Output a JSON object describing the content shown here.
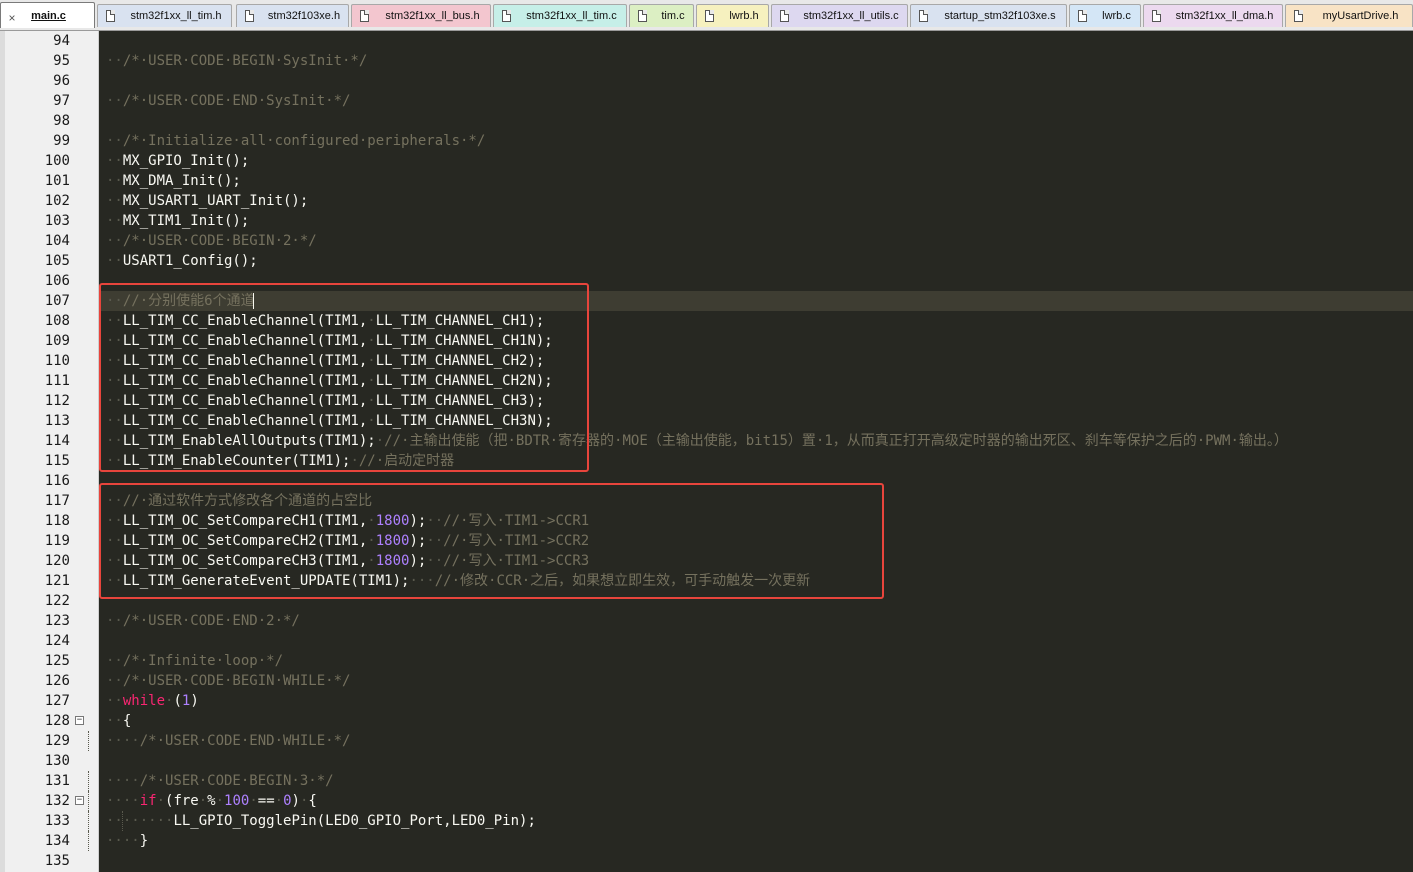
{
  "tabs": [
    {
      "label": "main.c",
      "color": "#ffffff",
      "active": true
    },
    {
      "label": "stm32f1xx_ll_tim.h",
      "color": "#d9e2f0"
    },
    {
      "label": "stm32f103xe.h",
      "color": "#d9e2f0"
    },
    {
      "label": "stm32f1xx_ll_bus.h",
      "color": "#f3c6cf"
    },
    {
      "label": "stm32f1xx_ll_tim.c",
      "color": "#c6efe8"
    },
    {
      "label": "tim.c",
      "color": "#dcefc3"
    },
    {
      "label": "lwrb.h",
      "color": "#f6f1bf"
    },
    {
      "label": "stm32f1xx_ll_utils.c",
      "color": "#ddd8f0"
    },
    {
      "label": "startup_stm32f103xe.s",
      "color": "#d9e2f0"
    },
    {
      "label": "lwrb.c",
      "color": "#d4e6f6"
    },
    {
      "label": "stm32f1xx_ll_dma.h",
      "color": "#ecd9ef"
    },
    {
      "label": "myUsartDrive.h",
      "color": "#f8e3c5"
    }
  ],
  "tab_close_glyph": "×",
  "lines": [
    {
      "n": "94",
      "code": ""
    },
    {
      "n": "95",
      "code": "  /* USER CODE BEGIN SysInit */"
    },
    {
      "n": "96",
      "code": ""
    },
    {
      "n": "97",
      "code": "  /* USER CODE END SysInit */"
    },
    {
      "n": "98",
      "code": ""
    },
    {
      "n": "99",
      "code": "  /* Initialize all configured peripherals */"
    },
    {
      "n": "100",
      "code": "  MX_GPIO_Init();"
    },
    {
      "n": "101",
      "code": "  MX_DMA_Init();"
    },
    {
      "n": "102",
      "code": "  MX_USART1_UART_Init();"
    },
    {
      "n": "103",
      "code": "  MX_TIM1_Init();"
    },
    {
      "n": "104",
      "code": "  /* USER CODE BEGIN 2 */"
    },
    {
      "n": "105",
      "code": "  USART1_Config();"
    },
    {
      "n": "106",
      "code": ""
    },
    {
      "n": "107",
      "code": "  // 分别使能6个通道"
    },
    {
      "n": "108",
      "code": "  LL_TIM_CC_EnableChannel(TIM1, LL_TIM_CHANNEL_CH1);"
    },
    {
      "n": "109",
      "code": "  LL_TIM_CC_EnableChannel(TIM1, LL_TIM_CHANNEL_CH1N);"
    },
    {
      "n": "110",
      "code": "  LL_TIM_CC_EnableChannel(TIM1, LL_TIM_CHANNEL_CH2);"
    },
    {
      "n": "111",
      "code": "  LL_TIM_CC_EnableChannel(TIM1, LL_TIM_CHANNEL_CH2N);"
    },
    {
      "n": "112",
      "code": "  LL_TIM_CC_EnableChannel(TIM1, LL_TIM_CHANNEL_CH3);"
    },
    {
      "n": "113",
      "code": "  LL_TIM_CC_EnableChannel(TIM1, LL_TIM_CHANNEL_CH3N);"
    },
    {
      "n": "114",
      "code": "  LL_TIM_EnableAllOutputs(TIM1); // 主输出使能（把 BDTR 寄存器的 MOE（主输出使能，bit15）置 1，从而真正打开高级定时器的输出死区、刹车等保护之后的 PWM 输出。）"
    },
    {
      "n": "115",
      "code": "  LL_TIM_EnableCounter(TIM1); // 启动定时器"
    },
    {
      "n": "116",
      "code": ""
    },
    {
      "n": "117",
      "code": "  // 通过软件方式修改各个通道的占空比"
    },
    {
      "n": "118",
      "code": "  LL_TIM_OC_SetCompareCH1(TIM1, 1800);  // 写入 TIM1->CCR1"
    },
    {
      "n": "119",
      "code": "  LL_TIM_OC_SetCompareCH2(TIM1, 1800);  // 写入 TIM1->CCR2"
    },
    {
      "n": "120",
      "code": "  LL_TIM_OC_SetCompareCH3(TIM1, 1800);  // 写入 TIM1->CCR3"
    },
    {
      "n": "121",
      "code": "  LL_TIM_GenerateEvent_UPDATE(TIM1);   // 修改 CCR 之后，如果想立即生效，可手动触发一次更新"
    },
    {
      "n": "122",
      "code": ""
    },
    {
      "n": "123",
      "code": "  /* USER CODE END 2 */"
    },
    {
      "n": "124",
      "code": ""
    },
    {
      "n": "125",
      "code": "  /* Infinite loop */"
    },
    {
      "n": "126",
      "code": "  /* USER CODE BEGIN WHILE */"
    },
    {
      "n": "127",
      "code": "  while (1)"
    },
    {
      "n": "128",
      "code": "  {",
      "fold": "−"
    },
    {
      "n": "129",
      "code": "    /* USER CODE END WHILE */"
    },
    {
      "n": "130",
      "code": ""
    },
    {
      "n": "131",
      "code": "    /* USER CODE BEGIN 3 */"
    },
    {
      "n": "132",
      "code": "    if (fre % 100 == 0) {",
      "fold": "−"
    },
    {
      "n": "133",
      "code": "        LL_GPIO_TogglePin(LED0_GPIO_Port,LED0_Pin);"
    },
    {
      "n": "134",
      "code": "    }"
    },
    {
      "n": "135",
      "code": ""
    }
  ],
  "current_line": "107",
  "colors": {
    "background": "#272822",
    "comment": "#75715e",
    "keyword": "#f92672",
    "number": "#ae81ff",
    "text": "#f8f8f2",
    "current_line": "#3e3d32",
    "highlight_box": "#e8453c"
  }
}
